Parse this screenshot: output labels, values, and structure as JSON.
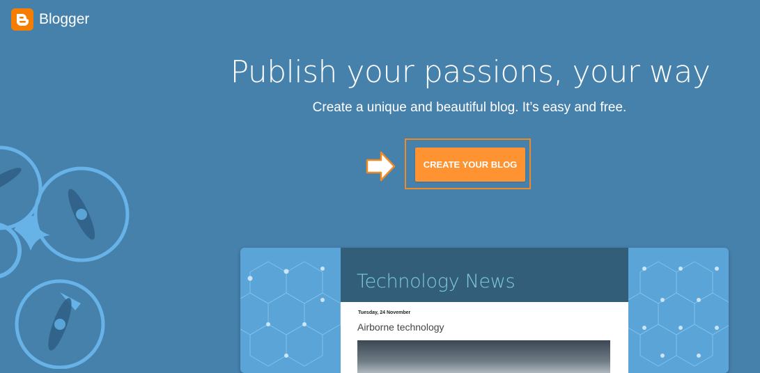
{
  "brand": {
    "name": "Blogger",
    "icon": "blogger-logo-icon",
    "logo_color": "#f57d00"
  },
  "hero": {
    "headline": "Publish your passions, your way",
    "subheadline": "Create a unique and beautiful blog. It’s easy and free.",
    "cta_label": "CREATE YOUR BLOG",
    "cta_color": "#ff9231",
    "highlight_color": "#f08a24"
  },
  "preview": {
    "blog_title": "Technology News",
    "post_date": "Tuesday, 24 November",
    "post_title": "Airborne technology"
  },
  "colors": {
    "background": "#4681ac",
    "preview_header": "#335e7a",
    "preview_pattern": "#5aa4d8"
  }
}
